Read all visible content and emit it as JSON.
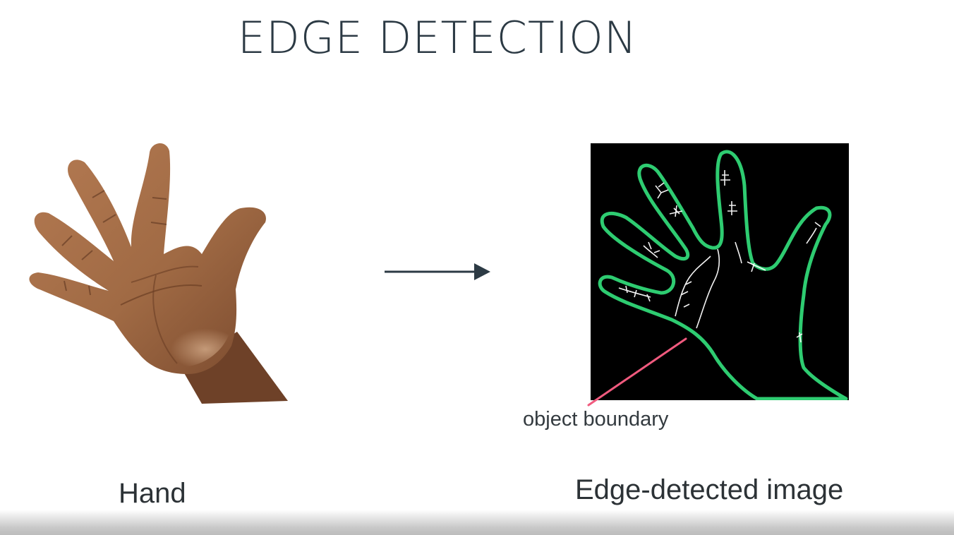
{
  "slide": {
    "title": "EDGE DETECTION",
    "left_label": "Hand",
    "right_label": "Edge-detected image",
    "annotation": "object boundary"
  },
  "colors": {
    "title_text": "#2c3a44",
    "skin": "#a8704a",
    "skin_shadow": "#7c4a2c",
    "arrow": "#2c3a44",
    "edge_background": "#000000",
    "boundary_outline": "#2ecc71",
    "inner_edges": "#ffffff",
    "pointer_line": "#f05a7e"
  },
  "icons": {
    "arrow": "right-arrow-icon"
  }
}
